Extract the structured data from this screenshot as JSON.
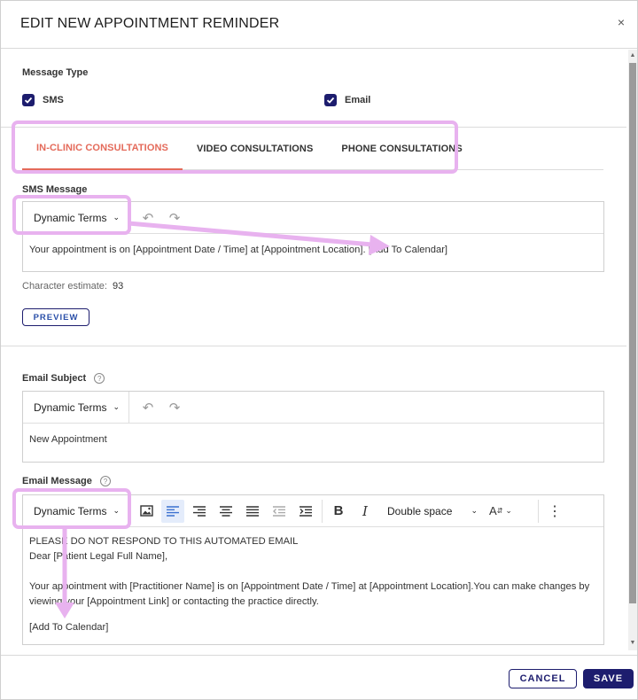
{
  "modal": {
    "title": "EDIT NEW APPOINTMENT REMINDER",
    "close": "×"
  },
  "message_type": {
    "label": "Message Type",
    "options": [
      {
        "label": "SMS",
        "checked": true
      },
      {
        "label": "Email",
        "checked": true
      }
    ]
  },
  "tabs": [
    {
      "label": "IN-CLINIC CONSULTATIONS",
      "active": true
    },
    {
      "label": "VIDEO CONSULTATIONS",
      "active": false
    },
    {
      "label": "PHONE CONSULTATIONS",
      "active": false
    }
  ],
  "sms": {
    "label": "SMS Message",
    "dynamic_terms": "Dynamic Terms",
    "body": "Your appointment is on [Appointment Date / Time] at [Appointment Location]. [Add To Calendar]",
    "estimate_label": "Character estimate:",
    "estimate_value": "93",
    "preview": "PREVIEW"
  },
  "email_subject": {
    "label": "Email Subject",
    "dynamic_terms": "Dynamic Terms",
    "body": "New Appointment"
  },
  "email_message": {
    "label": "Email Message",
    "dynamic_terms": "Dynamic Terms",
    "spacing": "Double space",
    "lines": [
      "PLEASE DO NOT RESPOND TO THIS AUTOMATED EMAIL",
      "Dear [Patient Legal Full Name],",
      "Your appointment with [Practitioner Name] is on [Appointment Date / Time] at [Appointment Location].You can make changes by viewing your [Appointment Link] or contacting the practice directly.",
      "[Add To Calendar]"
    ]
  },
  "footer": {
    "cancel": "CANCEL",
    "save": "SAVE"
  },
  "colors": {
    "primary": "#1d1d6e",
    "active_tab": "#e46a5a",
    "highlight": "#e8b2ef"
  }
}
